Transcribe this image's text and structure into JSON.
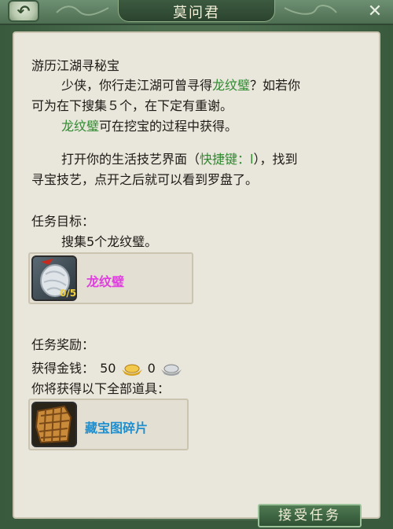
{
  "window": {
    "title": "莫问君",
    "back_icon": "back-arrow-icon",
    "close_icon": "close-icon"
  },
  "quest": {
    "name": "游历江湖寻秘宝",
    "desc_line1_a": "少侠，你行走江湖可曾寻得",
    "desc_line1_item": "龙纹璧",
    "desc_line1_b": "？如若你",
    "desc_line2": "可为在下搜集５个，在下定有重谢。",
    "desc_line3_item": "龙纹璧",
    "desc_line3_b": "可在挖宝的过程中获得。",
    "desc_line4_a": "打开你的生活技艺界面（",
    "desc_line4_hotkey": "快捷键：l",
    "desc_line4_b": "），找到",
    "desc_line5": "寻宝技艺，点开之后就可以看到罗盘了。"
  },
  "objective": {
    "heading": "任务目标：",
    "text": "搜集5个龙纹璧。",
    "item_name": "龙纹璧",
    "progress": "0/5",
    "item_color": "#e040e0"
  },
  "reward": {
    "heading": "任务奖励：",
    "money_label": "获得金钱：",
    "gold_amount": "50",
    "silver_amount": "0",
    "items_label": "你将获得以下全部道具：",
    "item_name": "藏宝图碎片",
    "item_color": "#1f8fd0"
  },
  "buttons": {
    "accept": "接受任务"
  }
}
